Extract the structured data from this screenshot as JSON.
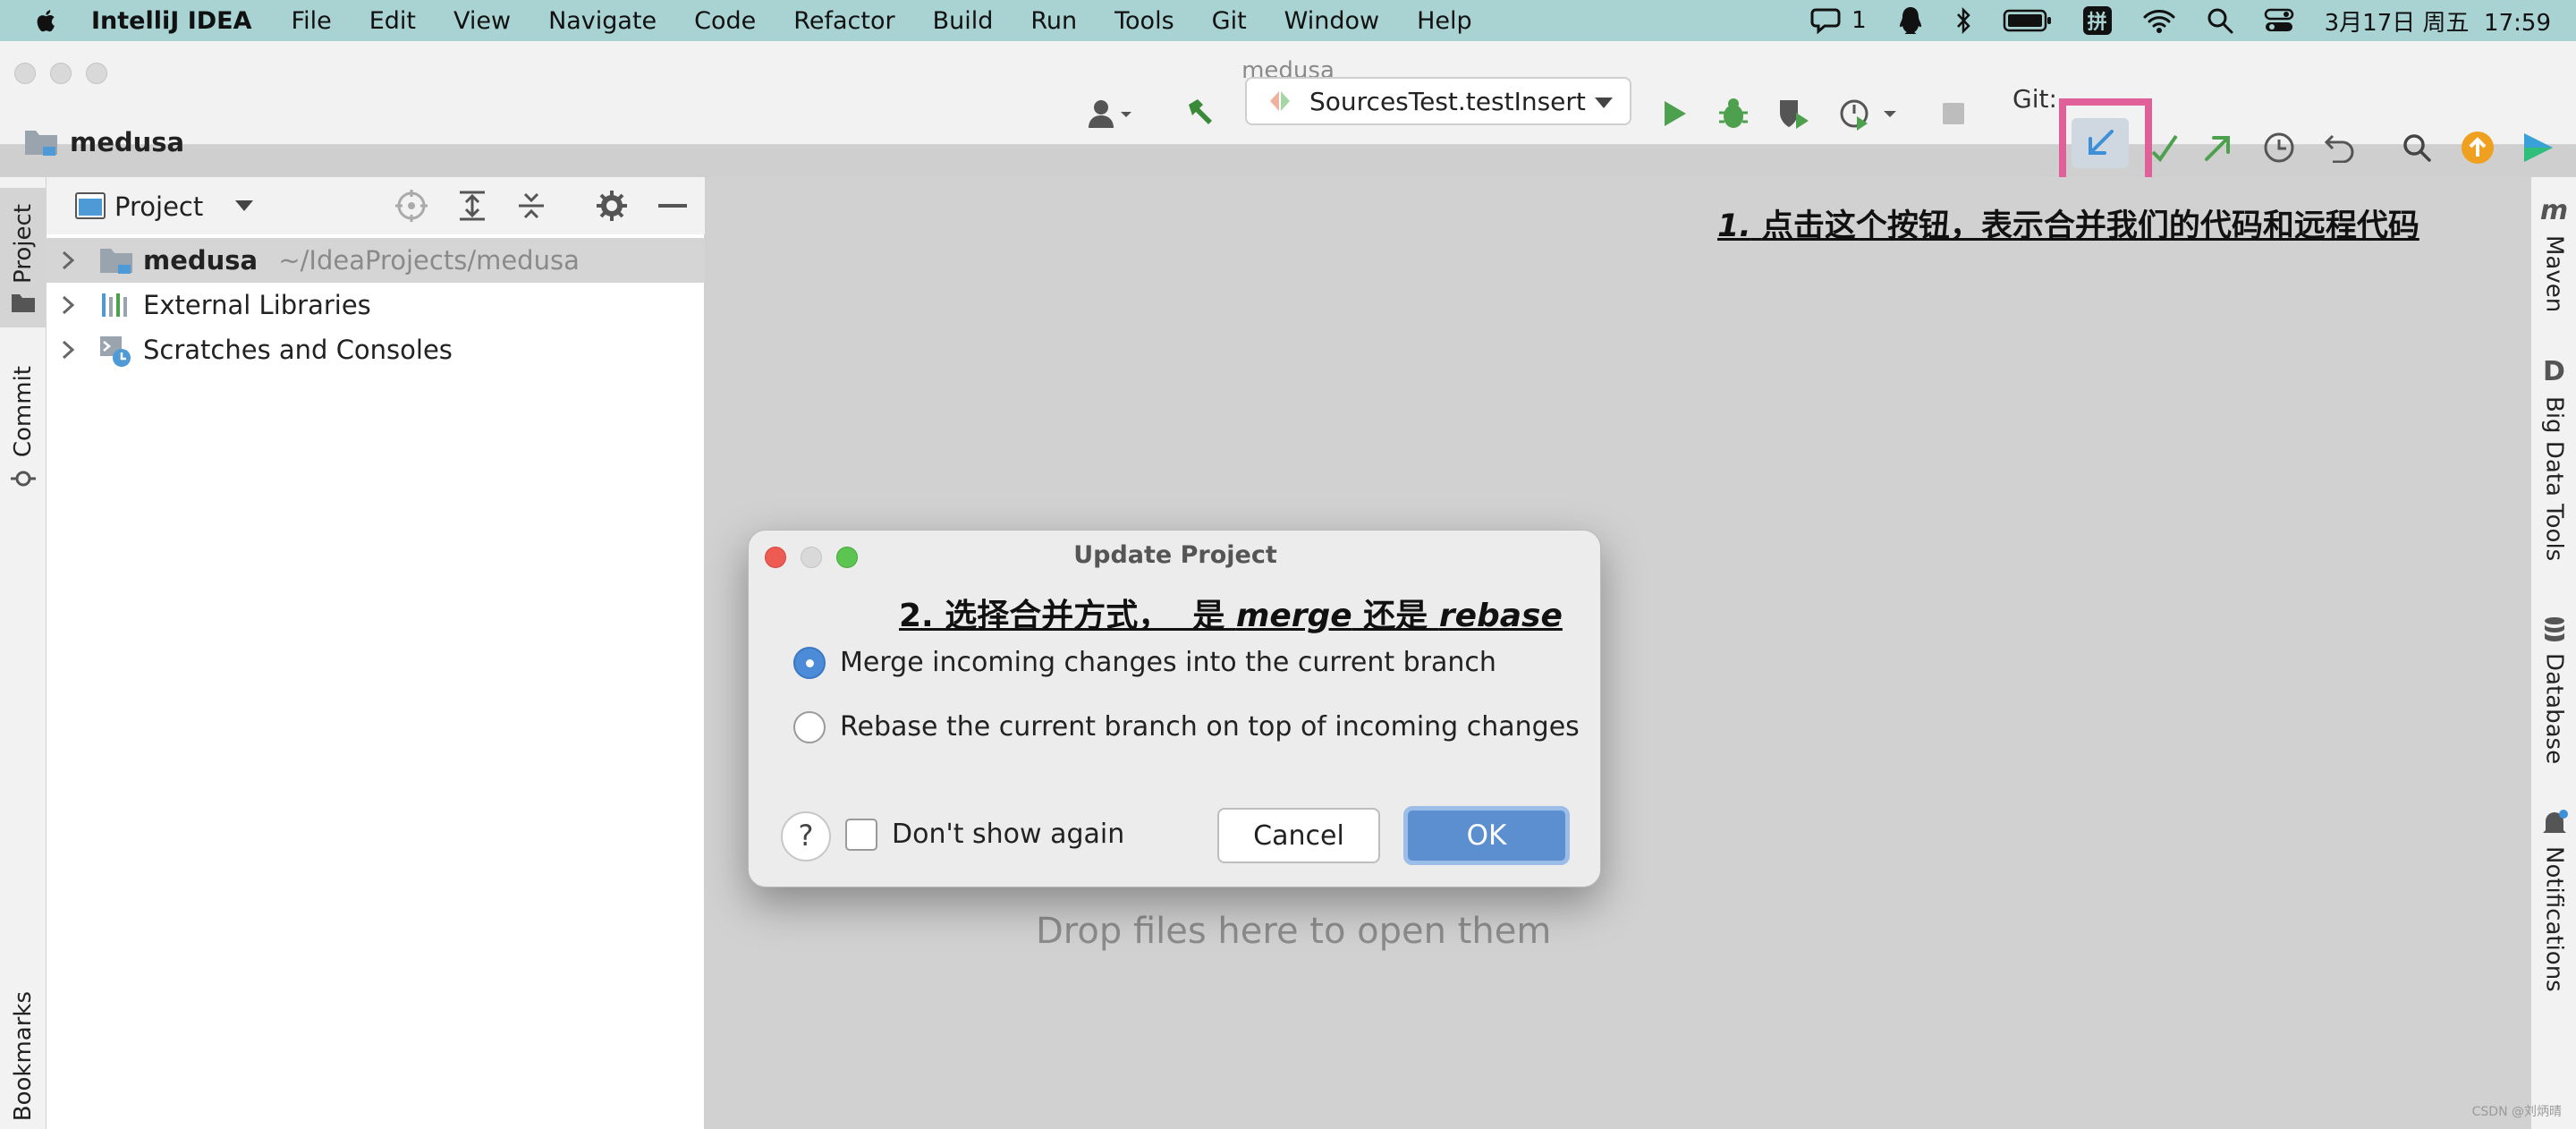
{
  "menubar": {
    "app_name": "IntelliJ IDEA",
    "items": [
      "File",
      "Edit",
      "View",
      "Navigate",
      "Code",
      "Refactor",
      "Build",
      "Run",
      "Tools",
      "Git",
      "Window",
      "Help"
    ],
    "status": {
      "chat_count": "1",
      "input_method": "拼",
      "datetime": "3月17日 周五  17:59"
    }
  },
  "window": {
    "title": "medusa",
    "project_name": "medusa"
  },
  "toolbar": {
    "run_config": "SourcesTest.testInsert",
    "git_label": "Git:"
  },
  "left_tabs": {
    "project": "Project",
    "commit": "Commit",
    "bookmarks": "Bookmarks"
  },
  "project_panel": {
    "title": "Project",
    "tree": [
      {
        "label": "medusa",
        "path": "~/IdeaProjects/medusa"
      },
      {
        "label": "External Libraries"
      },
      {
        "label": "Scratches and Consoles"
      }
    ]
  },
  "editor": {
    "annotation_1_num": "1.",
    "annotation_1_text": "点击这个按钮，表示合并我们的代码和远程代码",
    "drop_hint": "Drop files here to open them"
  },
  "right_tabs": {
    "maven": "Maven",
    "big_data_tools": "Big Data Tools",
    "database": "Database",
    "notifications": "Notifications"
  },
  "dialog": {
    "title": "Update Project",
    "annotation_2_prefix": "2. 选择合并方式，  是 ",
    "annotation_2_merge": "merge",
    "annotation_2_mid": " 还是 ",
    "annotation_2_rebase": "rebase",
    "options": [
      {
        "label": "Merge incoming changes into the current branch",
        "selected": true
      },
      {
        "label": "Rebase the current branch on top of incoming changes",
        "selected": false
      }
    ],
    "help_label": "?",
    "dont_show_label": "Don't show again",
    "cancel_label": "Cancel",
    "ok_label": "OK"
  },
  "watermark": "CSDN @刘炳晴",
  "colors": {
    "accent": "#5b8fd0",
    "highlight_box": "#e0609a",
    "menubar": "#a9d2d2"
  }
}
